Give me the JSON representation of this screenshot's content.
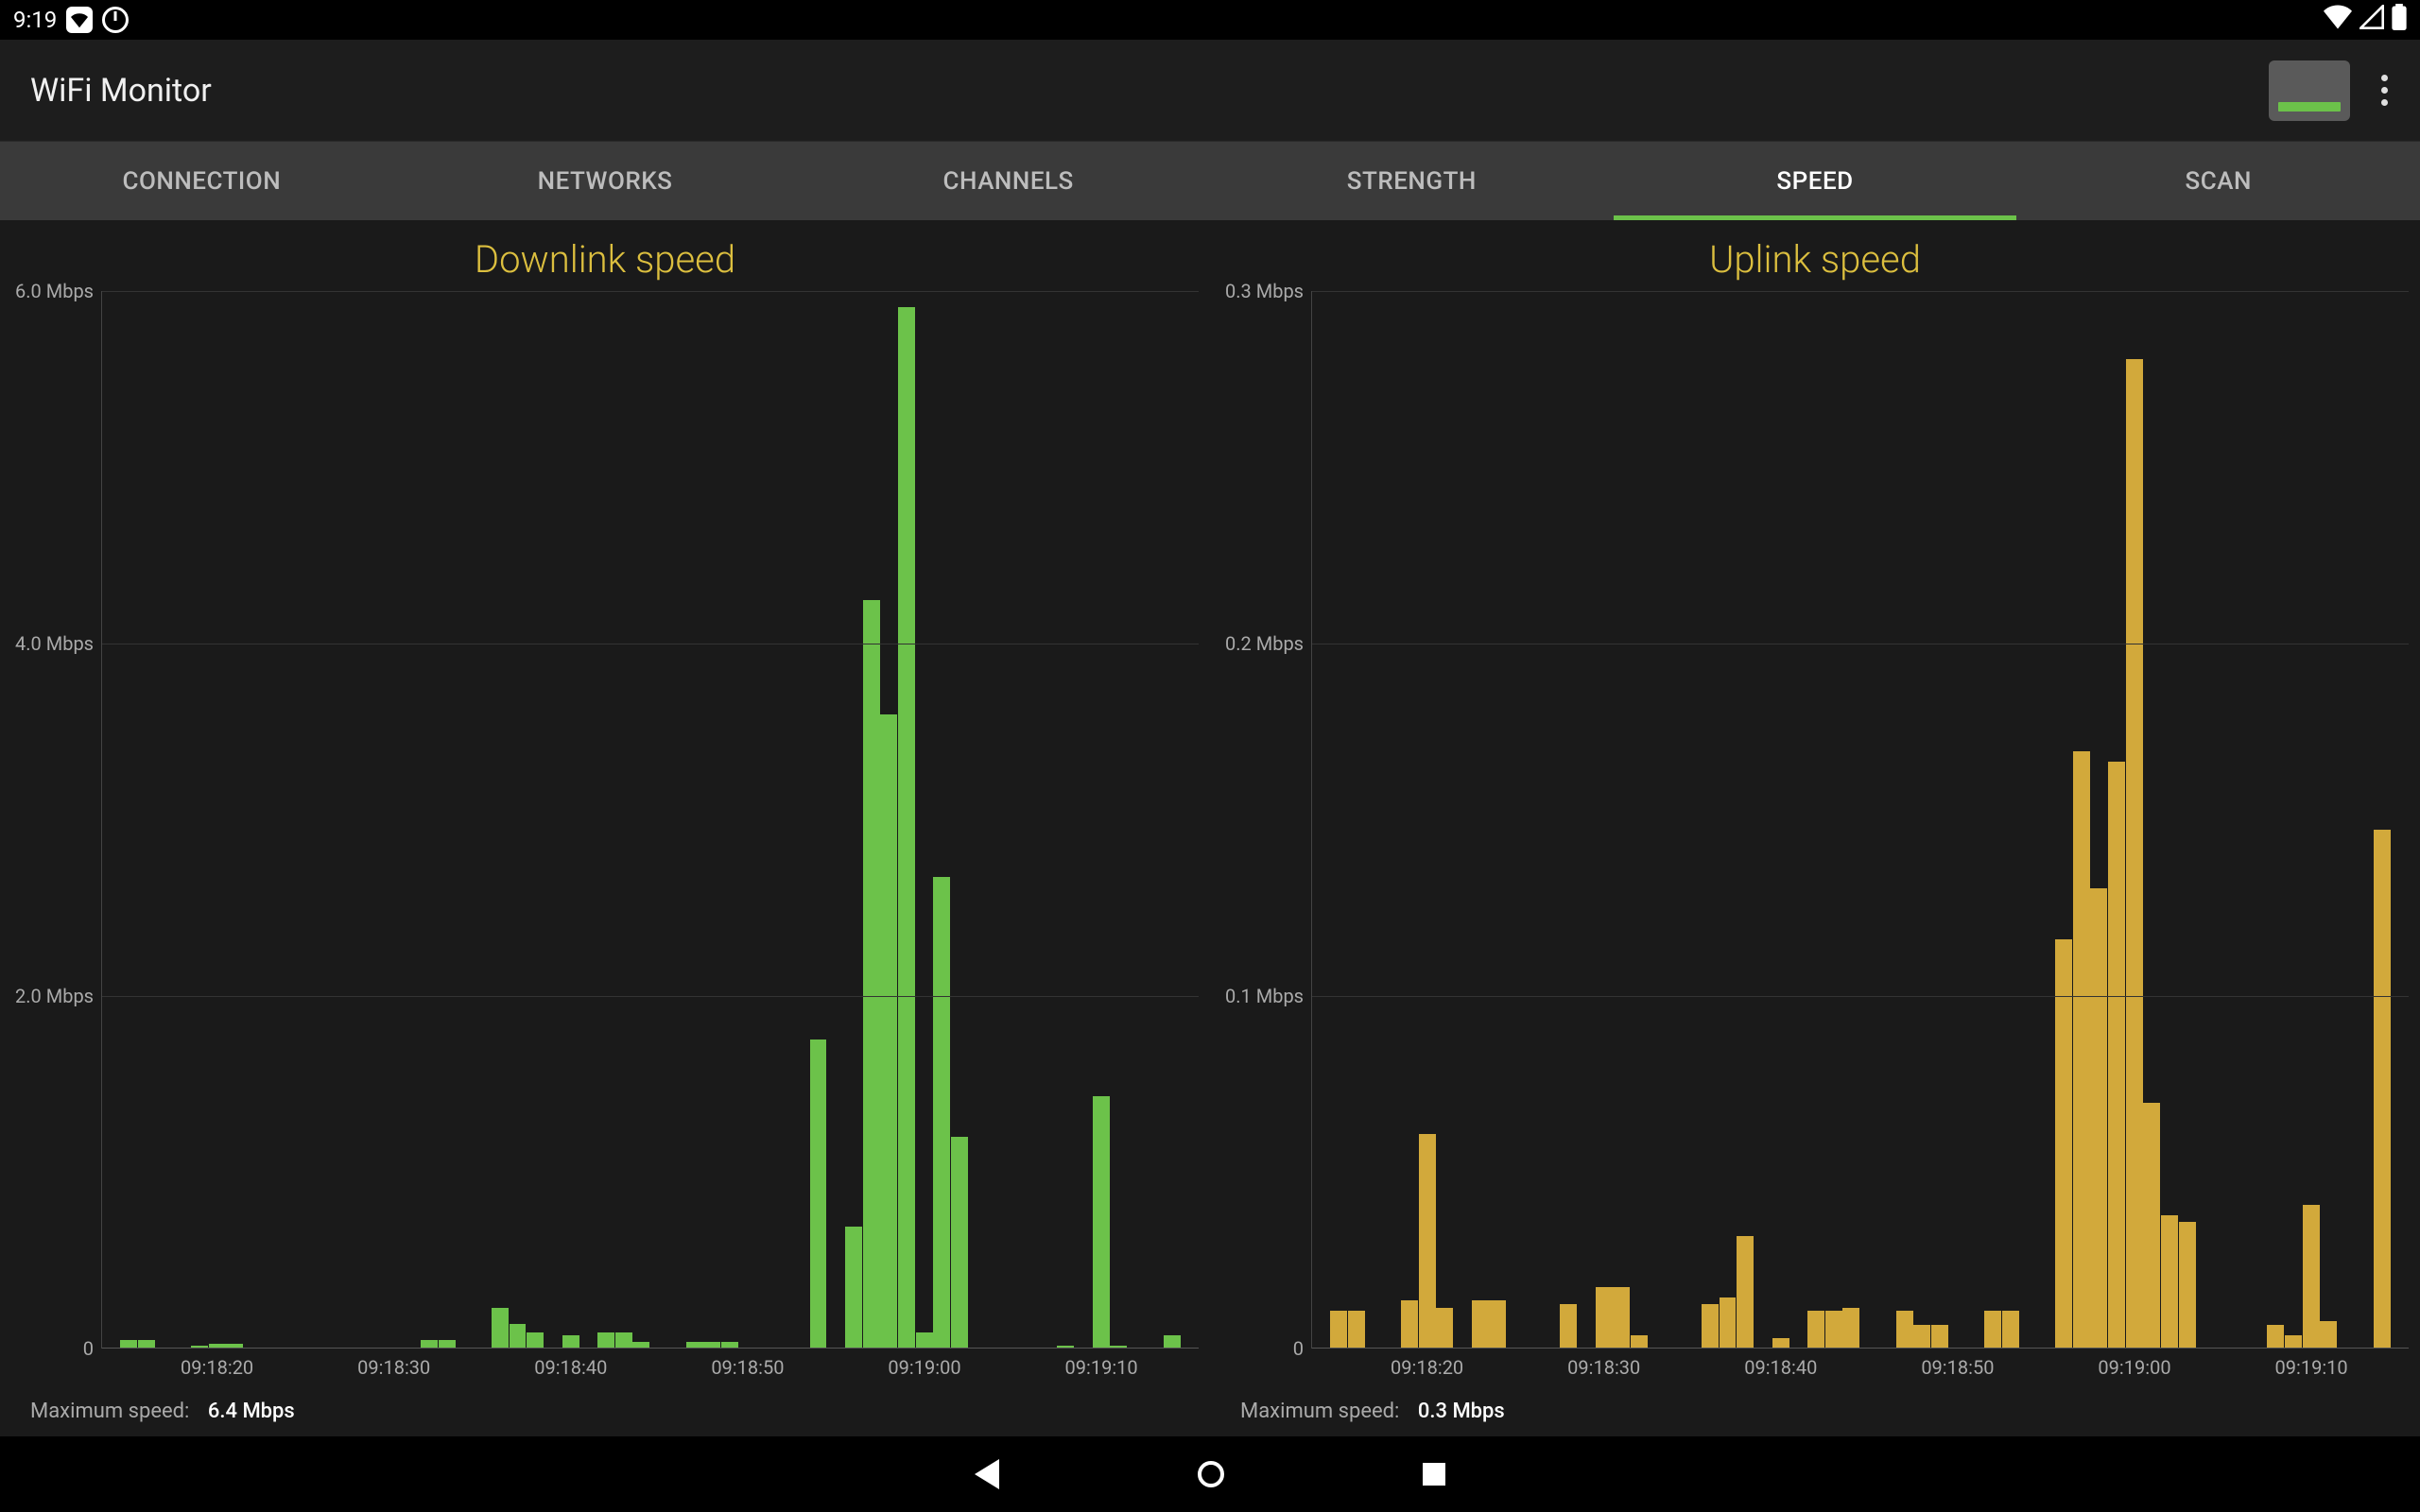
{
  "status_bar": {
    "time": "9:19"
  },
  "title_bar": {
    "title": "WiFi Monitor"
  },
  "tabs": [
    {
      "label": "CONNECTION",
      "active": false
    },
    {
      "label": "NETWORKS",
      "active": false
    },
    {
      "label": "CHANNELS",
      "active": false
    },
    {
      "label": "STRENGTH",
      "active": false
    },
    {
      "label": "SPEED",
      "active": true
    },
    {
      "label": "SCAN",
      "active": false
    }
  ],
  "downlink": {
    "title": "Downlink speed",
    "footer_label": "Maximum speed:",
    "footer_value": "6.4 Mbps",
    "color": "#6cc24a"
  },
  "uplink": {
    "title": "Uplink speed",
    "footer_label": "Maximum speed:",
    "footer_value": "0.3 Mbps",
    "color": "#d2a93b"
  },
  "chart_data": [
    {
      "name": "downlink",
      "type": "bar",
      "xlabel": "",
      "ylabel": "Mbps",
      "ylim": [
        0,
        6.5
      ],
      "y_ticks": [
        "0",
        "2.0 Mbps",
        "4.0 Mbps",
        "6.0 Mbps"
      ],
      "x_ticks": [
        "09:18:20",
        "09:18:30",
        "09:18:40",
        "09:18:50",
        "09:19:00",
        "09:19:10"
      ],
      "categories": [
        "09:18:14",
        "09:18:15",
        "09:18:16",
        "09:18:17",
        "09:18:18",
        "09:18:19",
        "09:18:20",
        "09:18:21",
        "09:18:22",
        "09:18:23",
        "09:18:24",
        "09:18:25",
        "09:18:26",
        "09:18:27",
        "09:18:28",
        "09:18:29",
        "09:18:30",
        "09:18:31",
        "09:18:32",
        "09:18:33",
        "09:18:34",
        "09:18:35",
        "09:18:36",
        "09:18:37",
        "09:18:38",
        "09:18:39",
        "09:18:40",
        "09:18:41",
        "09:18:42",
        "09:18:43",
        "09:18:44",
        "09:18:45",
        "09:18:46",
        "09:18:47",
        "09:18:48",
        "09:18:49",
        "09:18:50",
        "09:18:51",
        "09:18:52",
        "09:18:53",
        "09:18:54",
        "09:18:55",
        "09:18:56",
        "09:18:57",
        "09:18:58",
        "09:18:59",
        "09:19:00",
        "09:19:01",
        "09:19:02",
        "09:19:03",
        "09:19:04",
        "09:19:05",
        "09:19:06",
        "09:19:07",
        "09:19:08",
        "09:19:09",
        "09:19:10",
        "09:19:11",
        "09:19:12",
        "09:19:13",
        "09:19:14",
        "09:19:15"
      ],
      "values": [
        0,
        0.05,
        0.05,
        0,
        0,
        0.02,
        0.03,
        0.03,
        0,
        0,
        0,
        0,
        0,
        0,
        0,
        0,
        0,
        0,
        0.05,
        0.05,
        0,
        0,
        0.25,
        0.15,
        0.1,
        0,
        0.08,
        0,
        0.1,
        0.1,
        0.04,
        0,
        0,
        0.04,
        0.04,
        0.04,
        0,
        0,
        0,
        0,
        1.9,
        0,
        0.75,
        4.6,
        3.9,
        6.4,
        0.1,
        2.9,
        1.3,
        0,
        0,
        0,
        0,
        0,
        0.02,
        0,
        1.55,
        0.02,
        0,
        0,
        0.08,
        0
      ]
    },
    {
      "name": "uplink",
      "type": "bar",
      "xlabel": "",
      "ylabel": "Mbps",
      "ylim": [
        0,
        0.31
      ],
      "y_ticks": [
        "0",
        "0.1 Mbps",
        "0.2 Mbps",
        "0.3 Mbps"
      ],
      "x_ticks": [
        "09:18:20",
        "09:18:30",
        "09:18:40",
        "09:18:50",
        "09:19:00",
        "09:19:10"
      ],
      "categories": [
        "09:18:14",
        "09:18:15",
        "09:18:16",
        "09:18:17",
        "09:18:18",
        "09:18:19",
        "09:18:20",
        "09:18:21",
        "09:18:22",
        "09:18:23",
        "09:18:24",
        "09:18:25",
        "09:18:26",
        "09:18:27",
        "09:18:28",
        "09:18:29",
        "09:18:30",
        "09:18:31",
        "09:18:32",
        "09:18:33",
        "09:18:34",
        "09:18:35",
        "09:18:36",
        "09:18:37",
        "09:18:38",
        "09:18:39",
        "09:18:40",
        "09:18:41",
        "09:18:42",
        "09:18:43",
        "09:18:44",
        "09:18:45",
        "09:18:46",
        "09:18:47",
        "09:18:48",
        "09:18:49",
        "09:18:50",
        "09:18:51",
        "09:18:52",
        "09:18:53",
        "09:18:54",
        "09:18:55",
        "09:18:56",
        "09:18:57",
        "09:18:58",
        "09:18:59",
        "09:19:00",
        "09:19:01",
        "09:19:02",
        "09:19:03",
        "09:19:04",
        "09:19:05",
        "09:19:06",
        "09:19:07",
        "09:19:08",
        "09:19:09",
        "09:19:10",
        "09:19:11",
        "09:19:12",
        "09:19:13",
        "09:19:14",
        "09:19:15"
      ],
      "values": [
        0,
        0.011,
        0.011,
        0,
        0,
        0.014,
        0.063,
        0.012,
        0,
        0.014,
        0.014,
        0,
        0,
        0,
        0.013,
        0,
        0.018,
        0.018,
        0.004,
        0,
        0,
        0,
        0.013,
        0.015,
        0.033,
        0,
        0.003,
        0,
        0.011,
        0.011,
        0.012,
        0,
        0,
        0.011,
        0.007,
        0.007,
        0,
        0,
        0.011,
        0.011,
        0,
        0,
        0.12,
        0.175,
        0.135,
        0.172,
        0.29,
        0.072,
        0.039,
        0.037,
        0,
        0,
        0,
        0,
        0.007,
        0.004,
        0.042,
        0.008,
        0,
        0,
        0.152,
        0
      ]
    }
  ]
}
